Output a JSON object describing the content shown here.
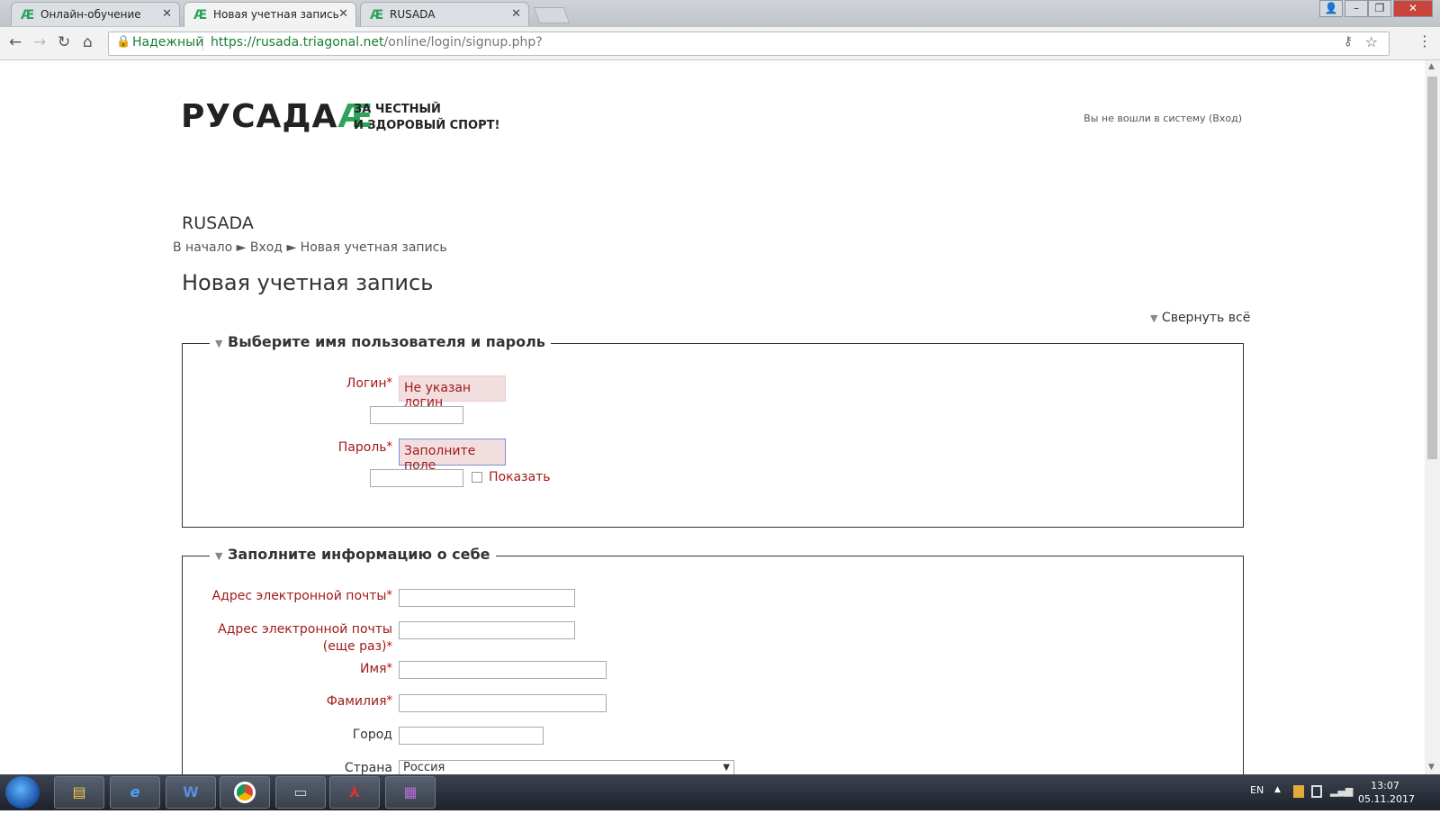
{
  "browser": {
    "tabs": [
      {
        "title": "Онлайн-обучение",
        "favicon": "rusada-favicon",
        "active": false
      },
      {
        "title": "Новая учетная запись",
        "favicon": "rusada-favicon",
        "active": true
      },
      {
        "title": "RUSADA",
        "favicon": "rusada-favicon",
        "active": false
      }
    ],
    "secure_label": "Надежный",
    "url_host": "https://rusada.triagonal.net",
    "url_path": "/online/login/signup.php?"
  },
  "page": {
    "logo_text": "РУСАДА",
    "logo_mark": "Æ",
    "tagline_line1": "ЗА ЧЕСТНЫЙ",
    "tagline_line2": "И ЗДОРОВЫЙ СПОРТ!",
    "login_info": "Вы не вошли в систему (Вход)",
    "site_name": "RUSADA",
    "breadcrumb": [
      "В начало",
      "Вход",
      "Новая учетная запись"
    ],
    "breadcrumb_sep": "►",
    "title": "Новая учетная запись",
    "collapse_all": "Свернуть всё",
    "section1": {
      "legend": "Выберите имя пользователя и пароль",
      "login_label": "Логин",
      "login_error": "Не указан логин",
      "password_label": "Пароль",
      "password_error": "Заполните поле",
      "show_label": "Показать"
    },
    "section2": {
      "legend": "Заполните информацию о себе",
      "email_label": "Адрес электронной почты",
      "email2_label_line1": "Адрес электронной почты",
      "email2_label_line2": "(еще раз)",
      "firstname_label": "Имя",
      "lastname_label": "Фамилия",
      "city_label": "Город",
      "country_label": "Страна",
      "country_value": "Россия"
    },
    "required_mark": "*"
  },
  "taskbar": {
    "apps": [
      "explorer",
      "internet-explorer",
      "word",
      "chrome",
      "remote-desktop",
      "acrobat",
      "winrar"
    ],
    "lang": "EN",
    "time": "13:07",
    "date": "05.11.2017"
  }
}
